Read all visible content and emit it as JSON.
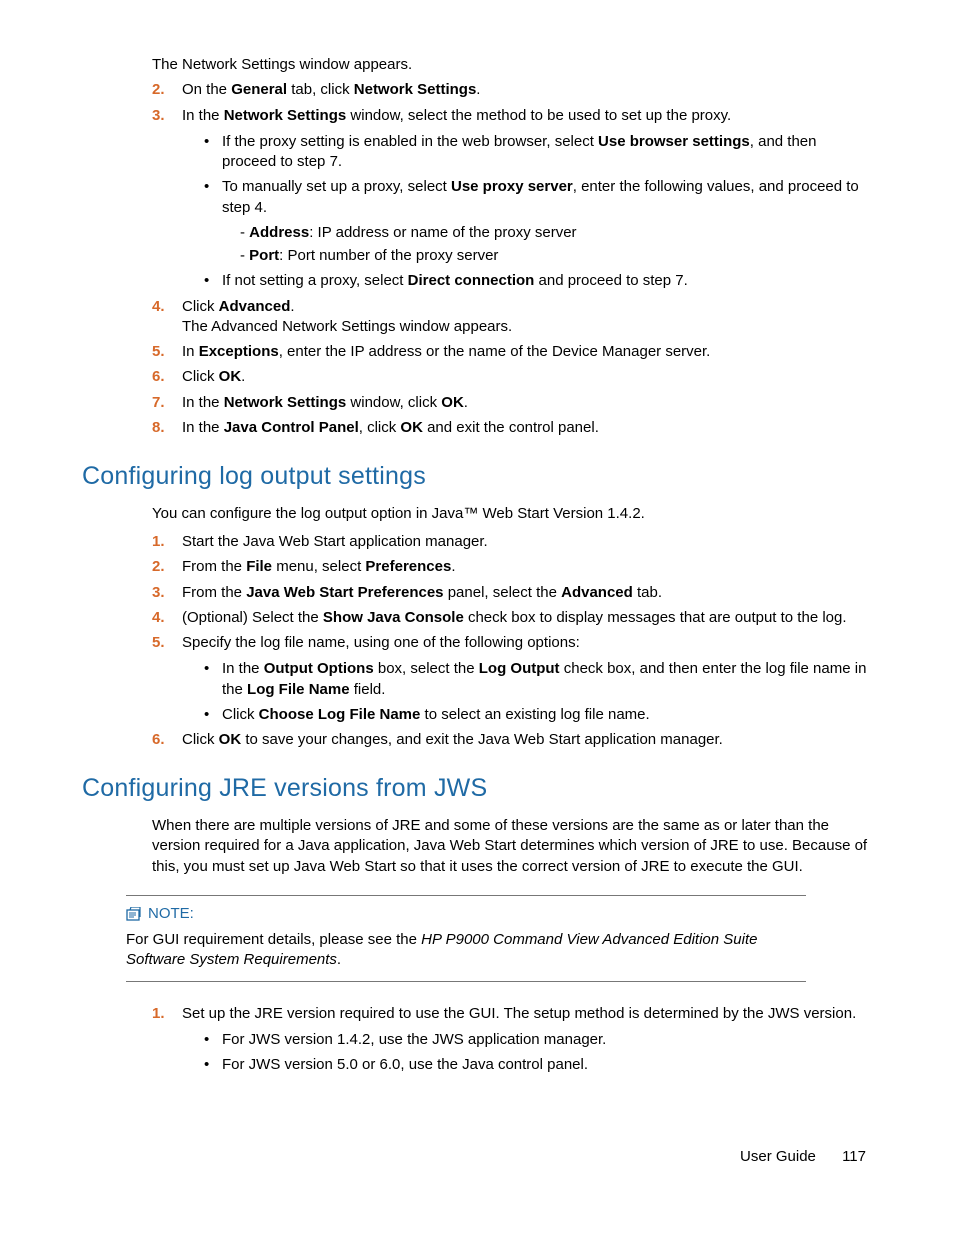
{
  "intro_after_step1": "The Network Settings window appears.",
  "steps_a": [
    {
      "n": "2.",
      "pre": "On the ",
      "b1": "General",
      "mid": " tab, click ",
      "b2": "Network Settings",
      "post": "."
    },
    {
      "n": "3.",
      "pre": "In the ",
      "b1": "Network Settings",
      "post": " window, select the method to be used to set up the proxy."
    }
  ],
  "bullets_3": [
    {
      "pre": "If the proxy setting is enabled in the web browser, select ",
      "b": "Use browser settings",
      "post": ", and then proceed to step 7."
    },
    {
      "pre": "To manually set up a proxy, select ",
      "b": "Use proxy server",
      "post": ", enter the following values, and proceed to step 4."
    },
    {
      "pre": "If not setting a proxy, select ",
      "b": "Direct connection",
      "post": " and proceed to step 7."
    }
  ],
  "sub_manual": [
    {
      "dash": "- ",
      "b": "Address",
      "post": ": IP address or name of the proxy server"
    },
    {
      "dash": "- ",
      "b": "Port",
      "post": ": Port number of the proxy server"
    }
  ],
  "step4_pre": "Click ",
  "step4_b": "Advanced",
  "step4_post": ".",
  "step4_after": "The Advanced Network Settings window appears.",
  "step5_pre": "In ",
  "step5_b": "Exceptions",
  "step5_post": ", enter the IP address or the name of the Device Manager server.",
  "step6_pre": "Click ",
  "step6_b": "OK",
  "step6_post": ".",
  "step7_pre": "In the ",
  "step7_b1": "Network Settings",
  "step7_mid": " window, click ",
  "step7_b2": "OK",
  "step7_post": ".",
  "step8_pre": "In the ",
  "step8_b1": "Java Control Panel",
  "step8_mid": ", click ",
  "step8_b2": "OK",
  "step8_post": " and exit the control panel.",
  "h2_log": "Configuring log output settings",
  "log_intro": "You can configure the log output option in Java™ Web Start Version 1.4.2.",
  "log_steps": {
    "1": "Start the Java Web Start application manager.",
    "2_pre": "From the ",
    "2_b1": "File",
    "2_mid": " menu, select ",
    "2_b2": "Preferences",
    "2_post": ".",
    "3_pre": "From the ",
    "3_b1": "Java Web Start Preferences",
    "3_mid": " panel, select the ",
    "3_b2": "Advanced",
    "3_post": " tab.",
    "4_pre": "(Optional) Select the ",
    "4_b": "Show Java Console",
    "4_post": " check box to display messages that are output to the log.",
    "5": "Specify the log file name, using one of the following options:",
    "6_pre": "Click ",
    "6_b": "OK",
    "6_post": " to save your changes, and exit the Java Web Start application manager."
  },
  "log_bul": [
    {
      "pre": "In the ",
      "b1": "Output Options",
      "mid": " box, select the ",
      "b2": "Log Output",
      "mid2": " check box, and then enter the log file name in the ",
      "b3": "Log File Name",
      "post": " field."
    },
    {
      "pre": "Click ",
      "b1": "Choose Log File Name",
      "post": " to select an existing log file name."
    }
  ],
  "h2_jre": "Configuring JRE versions from JWS",
  "jre_intro": "When there are multiple versions of JRE and some of these versions are the same as or later than the version required for a Java application, Java Web Start determines which version of JRE to use. Because of this, you must set up Java Web Start so that it uses the correct version of JRE to execute the GUI.",
  "note_label": "NOTE:",
  "note_pre": "For GUI requirement details, please see the ",
  "note_em": "HP P9000 Command View Advanced Edition Suite Software System Requirements",
  "note_post": ".",
  "jre_step1": "Set up the JRE version required to use the GUI. The setup method is determined by the JWS version.",
  "jre_bul": [
    "For JWS version 1.4.2, use the JWS application manager.",
    "For JWS version 5.0 or 6.0, use the Java control panel."
  ],
  "footer_label": "User Guide",
  "footer_page": "117"
}
